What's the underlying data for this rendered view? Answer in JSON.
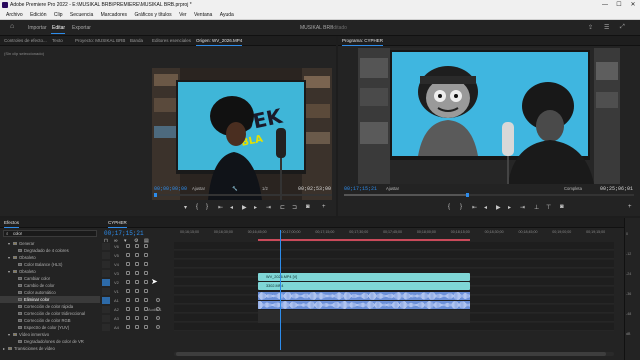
{
  "titlebar": {
    "title": "Adobe Premiere Pro 2022 - E:\\MUSIKAL BRB\\PREMIERE\\MUSIKAL BRB.prproj *",
    "minimize": "—",
    "maximize": "☐",
    "close": "✕"
  },
  "menubar": {
    "items": [
      "Archivo",
      "Edición",
      "Clip",
      "Secuencia",
      "Marcadores",
      "Gráficos y títulos",
      "Ver",
      "Ventana",
      "Ayuda"
    ]
  },
  "workspace": {
    "home_icon": "home-icon",
    "tabs": [
      "Importar",
      "Editar",
      "Exportar"
    ],
    "active_tab": "Editar",
    "center_title": "MUSIKAL BRB",
    "edited_label": "Editado"
  },
  "source_panel": {
    "tabs": [
      "Controles de efecto...",
      "Texto",
      "Proyecto: MUSIKAL BRB",
      "Banda",
      "Editores esenciales",
      "Origen: WV_2026.MP4"
    ],
    "active_tab": "Origen: WV_2026.MP4",
    "no_clip_text": "(Sin clip seleccionado)",
    "timecode_in": "00;00;00;00",
    "fit_label": "Ajustar",
    "page_label": "1/2",
    "timecode_duration": "00;02;53;00"
  },
  "program_panel": {
    "title": "Programa: CYPHER",
    "timecode": "00;17;15;21",
    "fit_label": "Ajustar",
    "quality_label": "Completa",
    "timecode_end": "00;25;06;01"
  },
  "effects_panel": {
    "title": "Efectos",
    "search_value": "color",
    "items": [
      {
        "label": "Generar",
        "indent": 1,
        "caret": "▾"
      },
      {
        "label": "Degradado de 4 colores",
        "indent": 2,
        "caret": ""
      },
      {
        "label": "Obsoleto",
        "indent": 1,
        "caret": "▾"
      },
      {
        "label": "Color Balance (HLS)",
        "indent": 2,
        "caret": ""
      },
      {
        "label": "Obsoleto",
        "indent": 1,
        "caret": "▾"
      },
      {
        "label": "Cambiar color",
        "indent": 2,
        "caret": ""
      },
      {
        "label": "Cambio de color",
        "indent": 2,
        "caret": ""
      },
      {
        "label": "Color automático",
        "indent": 2,
        "caret": ""
      },
      {
        "label": "Eliminar color",
        "indent": 2,
        "caret": "",
        "selected": true
      },
      {
        "label": "Corrección de color rápida",
        "indent": 2,
        "caret": ""
      },
      {
        "label": "Corrección de color tridireccional",
        "indent": 2,
        "caret": ""
      },
      {
        "label": "Corrección de color RGB",
        "indent": 2,
        "caret": ""
      },
      {
        "label": "Espectro de color (YUV)",
        "indent": 2,
        "caret": ""
      },
      {
        "label": "Vídeo inmersivo",
        "indent": 1,
        "caret": "▾"
      },
      {
        "label": "Degradado/ones de color de VR",
        "indent": 2,
        "caret": ""
      },
      {
        "label": "Transiciones de vídeo",
        "indent": 0,
        "caret": "▸"
      }
    ]
  },
  "timeline": {
    "sequence_tab": "CYPHER",
    "timecode": "00;17;15;21",
    "ruler_ticks": [
      "00;16;15;00",
      "00;16;30;00",
      "00;16;45;00",
      "00;17;00;00",
      "00;17;15;00",
      "00;17;30;00",
      "00;17;45;00",
      "00;18;00;00",
      "00;18;15;00",
      "00;18;30;00",
      "00;18;45;00",
      "00;19;00;00",
      "00;19;15;00"
    ],
    "tracks": [
      {
        "name": "V6"
      },
      {
        "name": "V5"
      },
      {
        "name": "V4"
      },
      {
        "name": "V3"
      },
      {
        "name": "V2"
      },
      {
        "name": "V1"
      },
      {
        "name": "A1"
      },
      {
        "name": "A2"
      },
      {
        "name": "A3"
      },
      {
        "name": "A4"
      }
    ],
    "audio_label": "Audio 1",
    "clips": {
      "v2": "WV_2026.MP4 [V]",
      "v1": "3302.MP4"
    },
    "program_progress": 0.42
  },
  "audio_meter": {
    "labels": [
      "0",
      "-12",
      "-24",
      "-36",
      "-48",
      "dB"
    ]
  },
  "colors": {
    "accent": "#2d8ceb",
    "clip_video": "#7fd6d6",
    "clip_audio": "#6a8fd8",
    "playhead": "#2d8ceb",
    "inout_range": "#c94a5a"
  }
}
